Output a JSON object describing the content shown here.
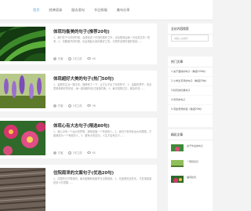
{
  "nav": [
    "首页",
    "经典语录",
    "励志语句",
    "节日祝福",
    "美句分享"
  ],
  "articles": [
    {
      "title": "体现均衡美的句子(推荐20句)",
      "desc": "1、我们在于与好的时候，会想到这个东西的美好之外，也会想到后面一天会发生的一些事。2、将要离开的时候，也会想起大量的美好之事，又很怀念那时候的场景......",
      "author": "扫客",
      "time": "2天之前",
      "views": "89"
    },
    {
      "title": "体现超好大美的句子(热门50句)",
      "desc": "1、温柔的生活一路平安，随便转了一下，让它认不出了你的样子。2、温馨的季节，来这里看看美好的风景，每一座城都有自己独特的美。3、每次回想过去，都会怀念......",
      "author": "扫客",
      "time": "2天之前",
      "views": "98"
    },
    {
      "title": "体现心有大志句子(精选80句)",
      "desc": "1、我心中有一个远大的梦想，那就是做一个有用的人。2、我们只有怀着远大的理想，才能够成为一个有用的人。3、要有大的志向，人生才会有意义......",
      "author": "扫客",
      "time": "2天之前",
      "views": "85"
    },
    {
      "title": "住院周泄的文案句子(优选20句)",
      "desc": "1、住院的日子很难熬，每天都期盼着能早日出院回家。2、在医院的这些天，才发现健康是多么的重要......",
      "author": "扫客",
      "time": "2天之前",
      "views": "92"
    }
  ],
  "sidebar": {
    "search_title": "全站内容搜索",
    "search_placeholder": "请输入关键字",
    "hot_title": "热门文章",
    "hot": [
      "1.关于爱情的句子（精选100句）",
      "2.小学生写景的句子（精选25句）",
      "3.秋天的优美句子",
      "4.风景的句子",
      "5.写给老师的话（精选20句）"
    ],
    "pic_title": "精彩文章",
    "pics": [
      "关于毕业的句子",
      "一周纪念日",
      "描写秋天"
    ]
  },
  "colors": {
    "accent": "#5ba3d0"
  }
}
